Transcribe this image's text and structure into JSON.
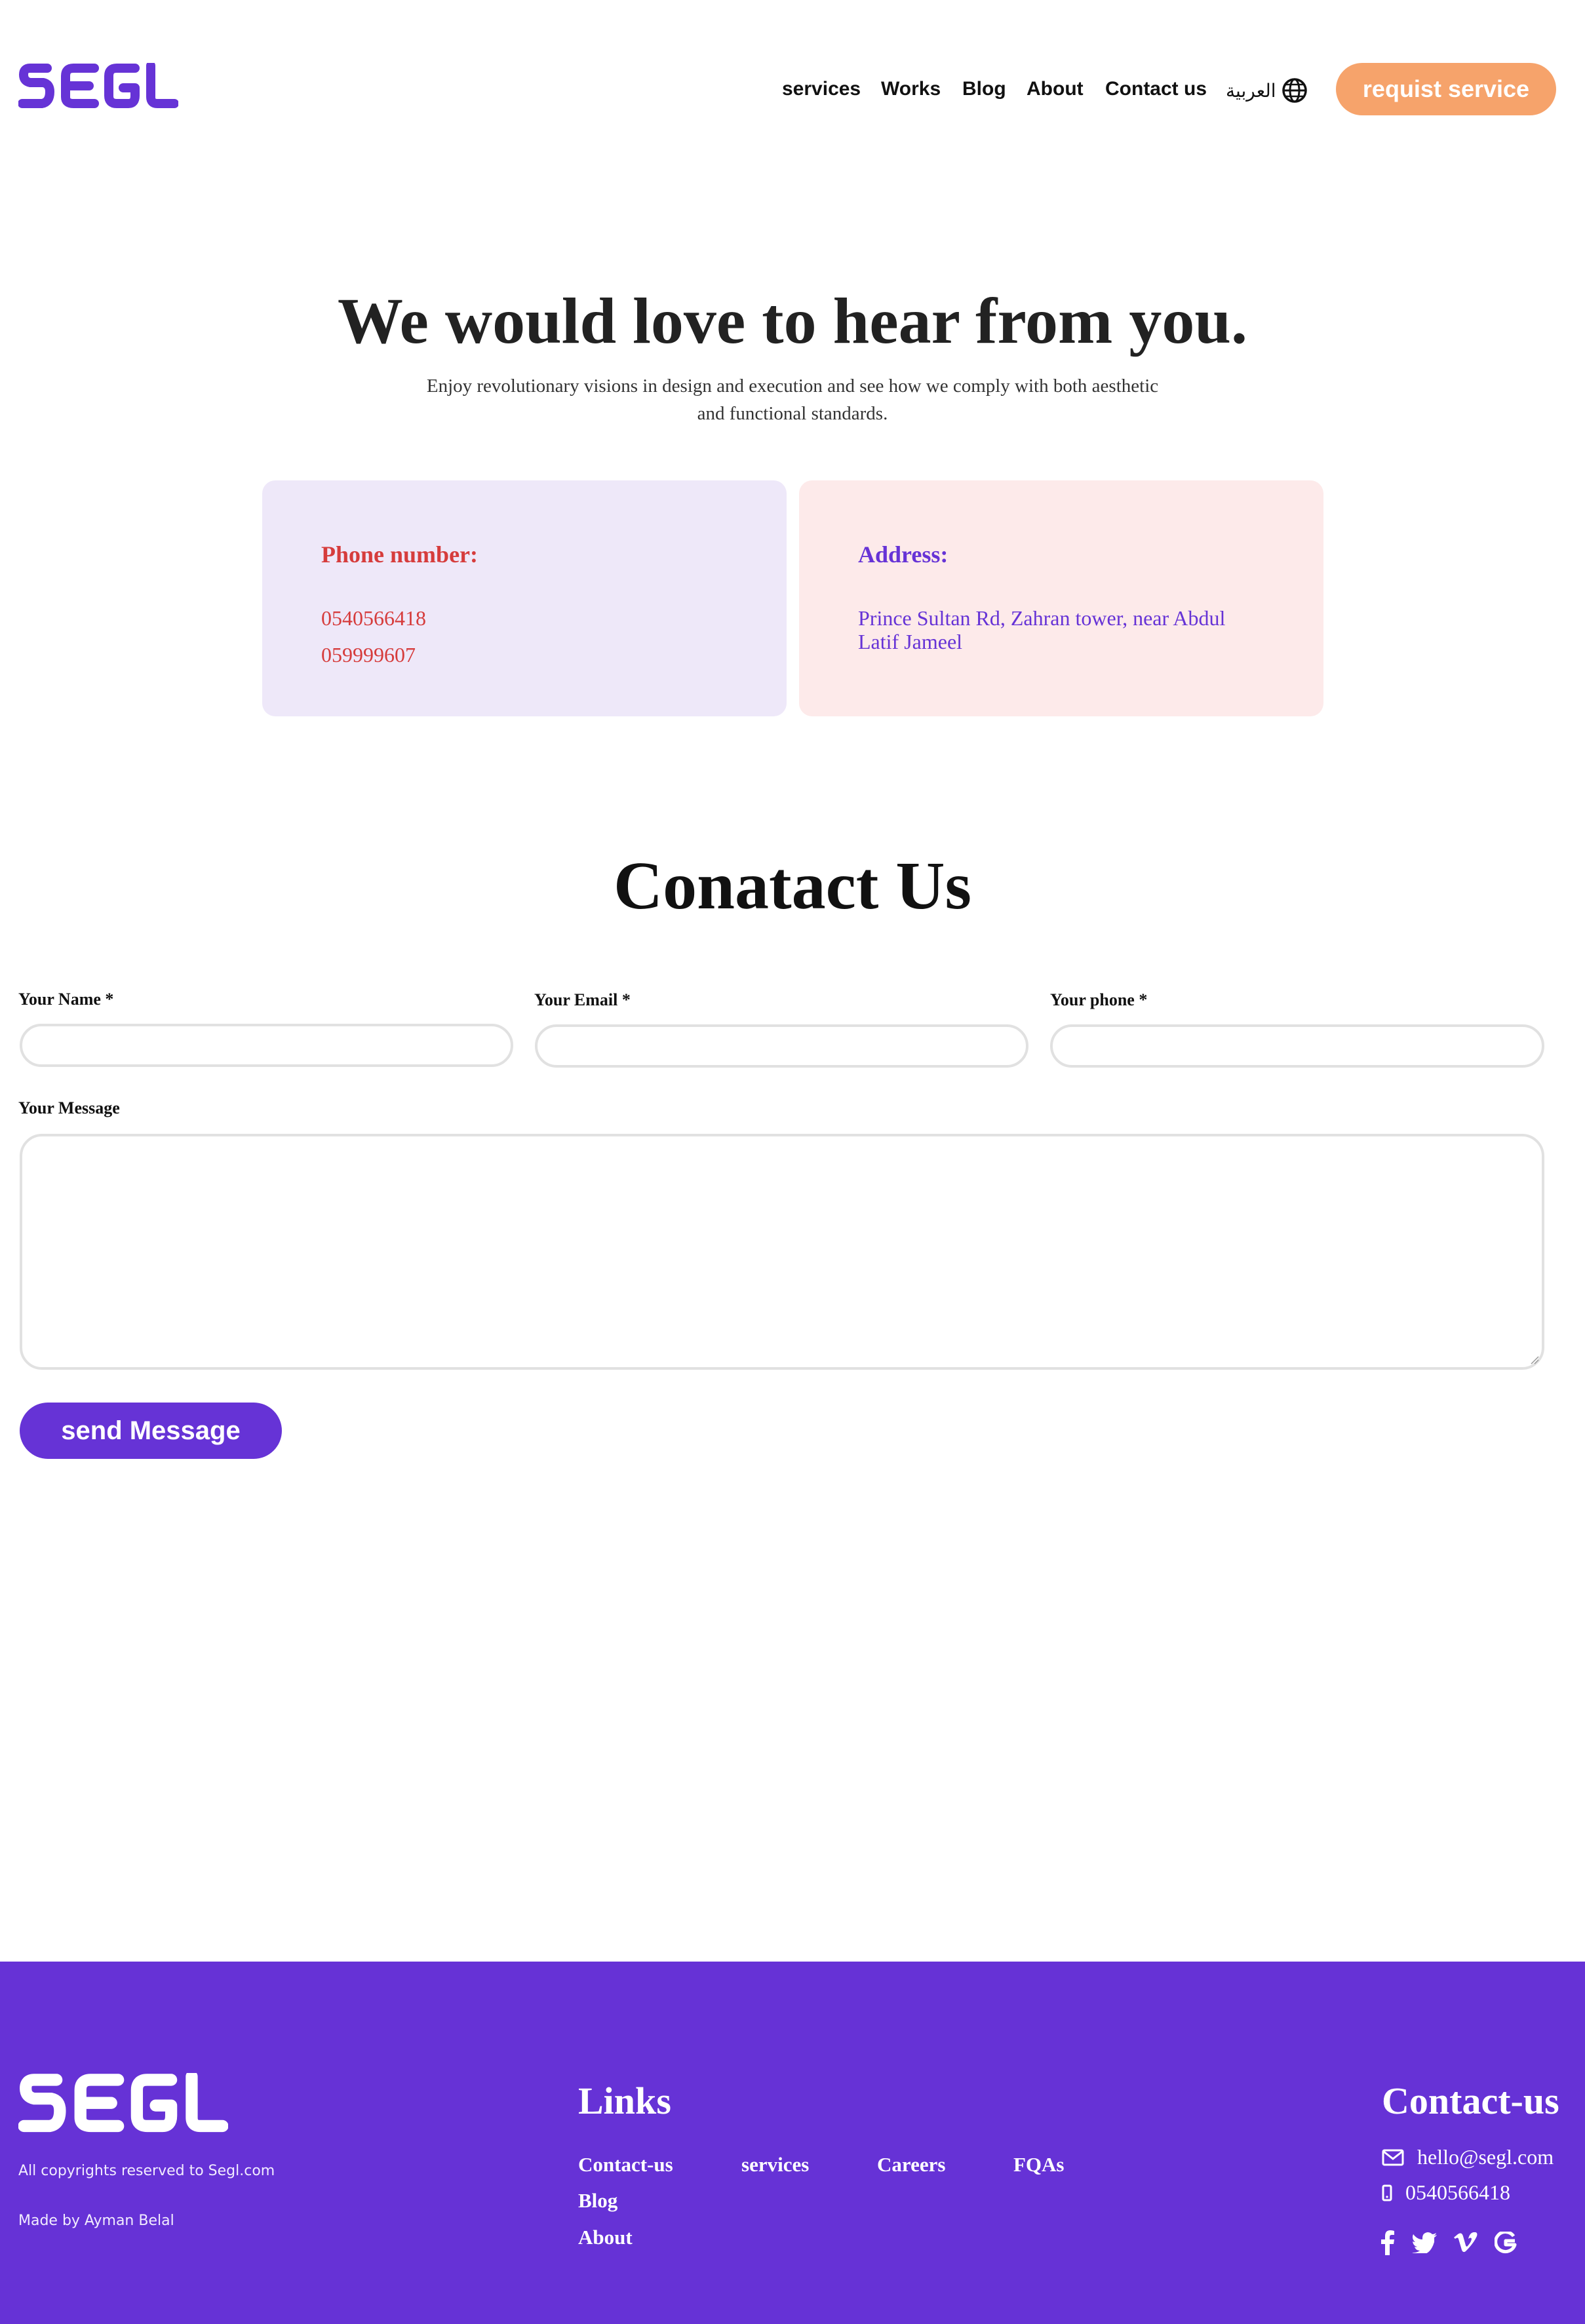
{
  "header": {
    "logo_text": "SEGL",
    "nav": [
      "services",
      "Works",
      "Blog",
      "About",
      "Contact us"
    ],
    "language": "العربية",
    "cta": "requist service"
  },
  "hero": {
    "title": "We would love to hear from you.",
    "subtitle_line1": "Enjoy revolutionary visions in design and execution and see how we comply with both aesthetic",
    "subtitle_line2": "and functional standards."
  },
  "cards": {
    "phone": {
      "title": "Phone number:",
      "numbers": [
        "0540566418",
        "059999607"
      ]
    },
    "address": {
      "title": "Address:",
      "line1": "Prince Sultan Rd, Zahran tower, near Abdul",
      "line2": "Latif Jameel"
    }
  },
  "form": {
    "title": "Conatact Us",
    "name_label": "Your Name *",
    "email_label": "Your Email *",
    "phone_label": "Your phone *",
    "message_label": "Your Message",
    "submit": "send Message"
  },
  "footer": {
    "copyright": "All copyrights reserved to Segl.com",
    "made_by": "Made by Ayman Belal",
    "links_title": "Links",
    "links": [
      "Contact-us",
      "services",
      "Careers",
      "FQAs",
      "Blog",
      "About"
    ],
    "contact_title": "Contact-us",
    "email": "hello@segl.com",
    "phone": "0540566418"
  },
  "colors": {
    "brand_purple": "#6632d6",
    "accent_orange": "#f6a36b",
    "phone_red": "#d63c3c"
  }
}
